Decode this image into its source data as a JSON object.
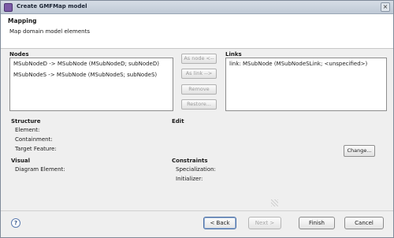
{
  "window": {
    "title": "Create GMFMap model",
    "close_glyph": "×"
  },
  "header": {
    "title": "Mapping",
    "description": "Map domain model elements"
  },
  "nodes": {
    "label": "Nodes",
    "items": [
      "MSubNodeD -> MSubNode (MSubNodeD; subNodeD)",
      "MSubNodeS -> MSubNode (MSubNodeS; subNodeS)"
    ]
  },
  "links": {
    "label": "Links",
    "items": [
      "link: MSubNode (MSubNodeSLink; <unspecified>)"
    ]
  },
  "middle_buttons": {
    "as_node": "As node <--",
    "as_link": "As link -->",
    "remove": "Remove",
    "restore": "Restore..."
  },
  "structure": {
    "label": "Structure",
    "element": "Element:",
    "containment": "Containment:",
    "target_feature": "Target Feature:"
  },
  "edit": {
    "label": "Edit",
    "change_button": "Change..."
  },
  "visual": {
    "label": "Visual",
    "diagram_element": "Diagram Element:"
  },
  "constraints": {
    "label": "Constraints",
    "specialization": "Specialization:",
    "initializer": "Initializer:"
  },
  "footer": {
    "help_glyph": "?",
    "back": "< Back",
    "next": "Next >",
    "finish": "Finish",
    "cancel": "Cancel"
  }
}
